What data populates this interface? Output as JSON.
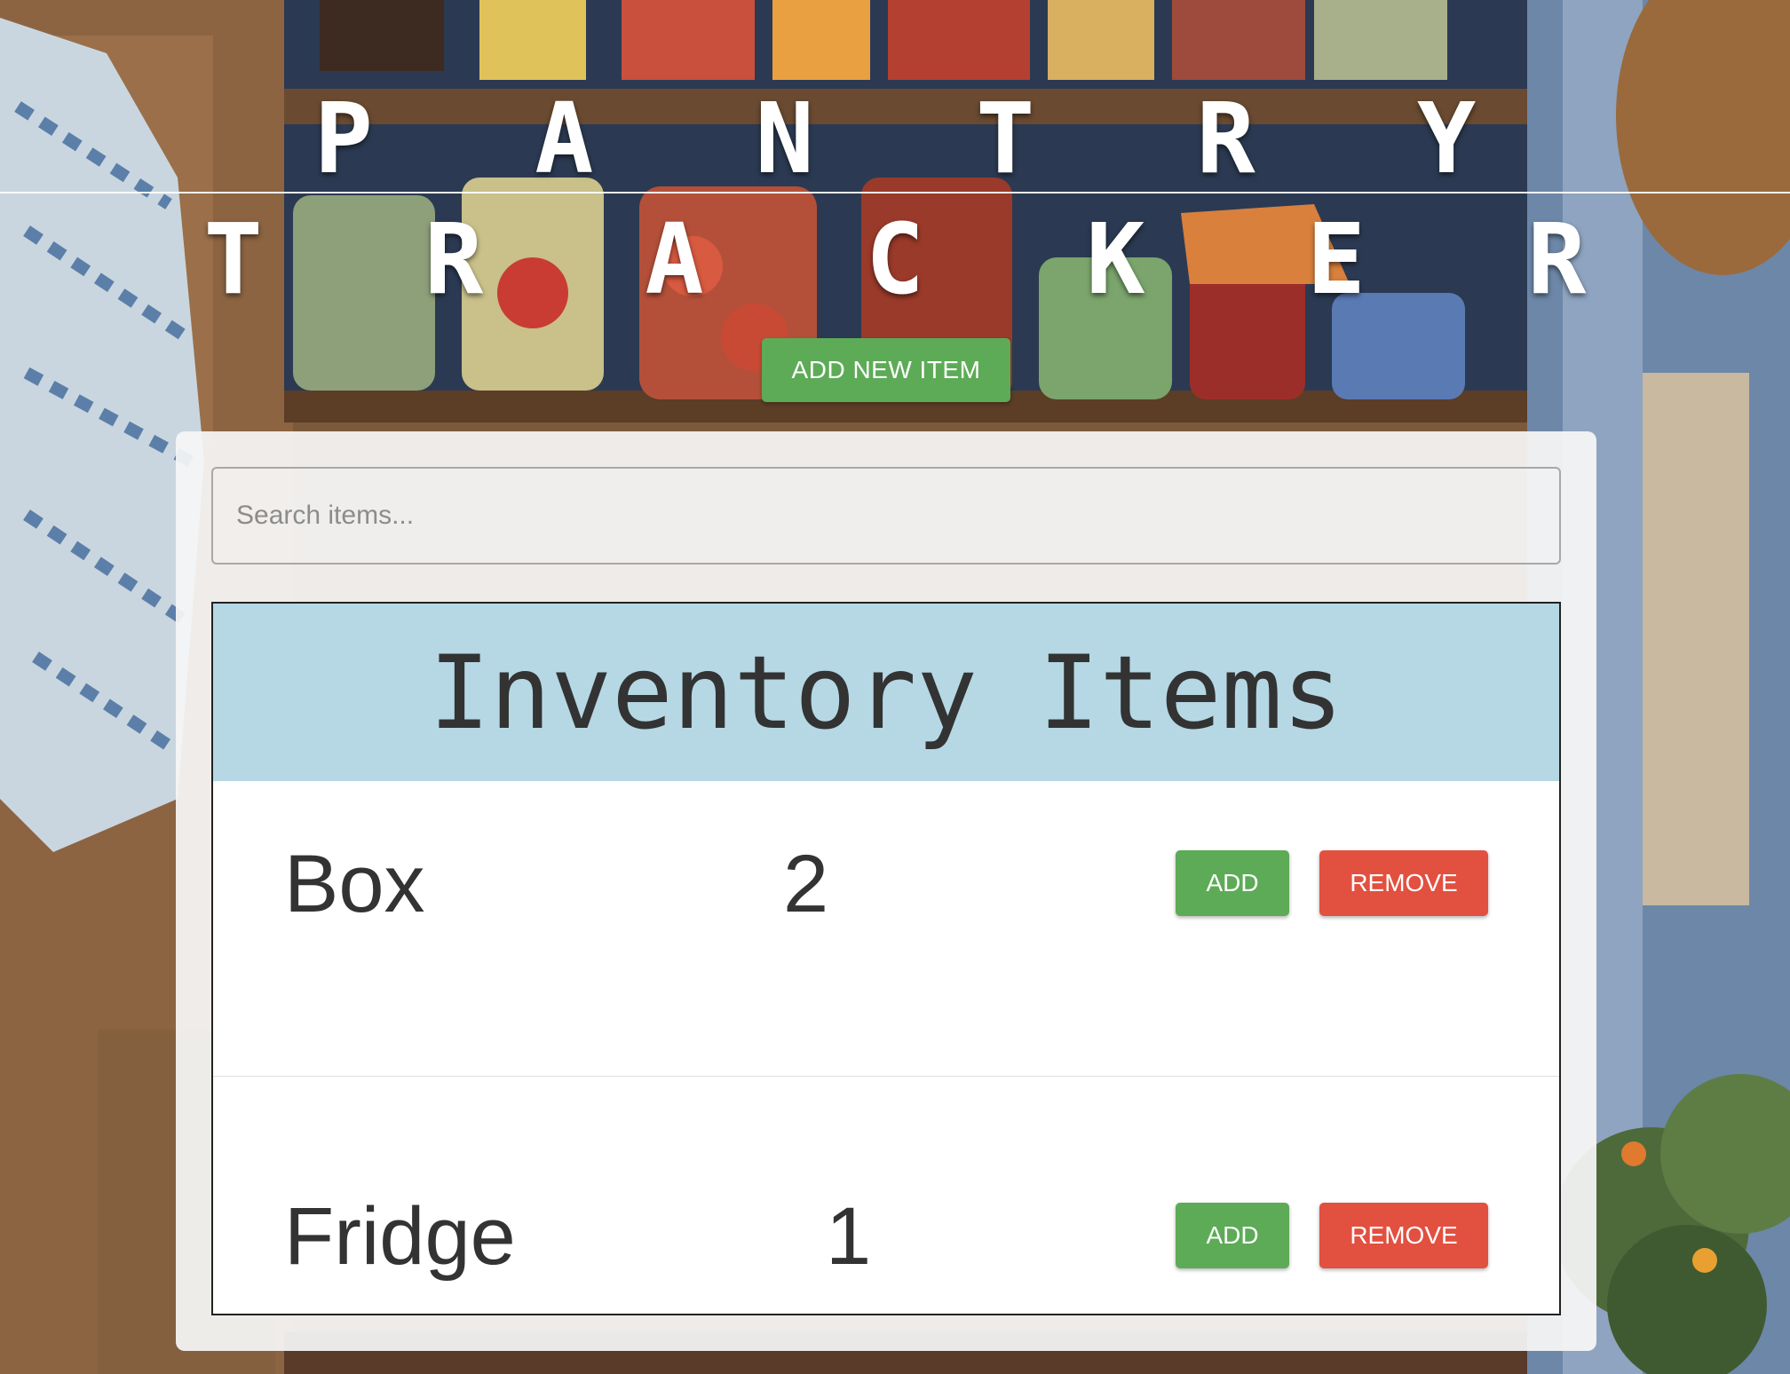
{
  "header": {
    "title_line1": "P A N T R Y",
    "title_line2": "T R A C K E R",
    "add_new_label": "ADD NEW ITEM"
  },
  "search": {
    "placeholder": "Search items...",
    "value": ""
  },
  "inventory": {
    "title": "Inventory Items",
    "items": [
      {
        "name": "Box",
        "quantity": "2",
        "add_label": "ADD",
        "remove_label": "REMOVE"
      },
      {
        "name": "Fridge",
        "quantity": "1",
        "add_label": "ADD",
        "remove_label": "REMOVE"
      }
    ]
  },
  "colors": {
    "add_green": "#5dab57",
    "remove_red": "#e25040",
    "header_blue": "#b5d8e4"
  }
}
